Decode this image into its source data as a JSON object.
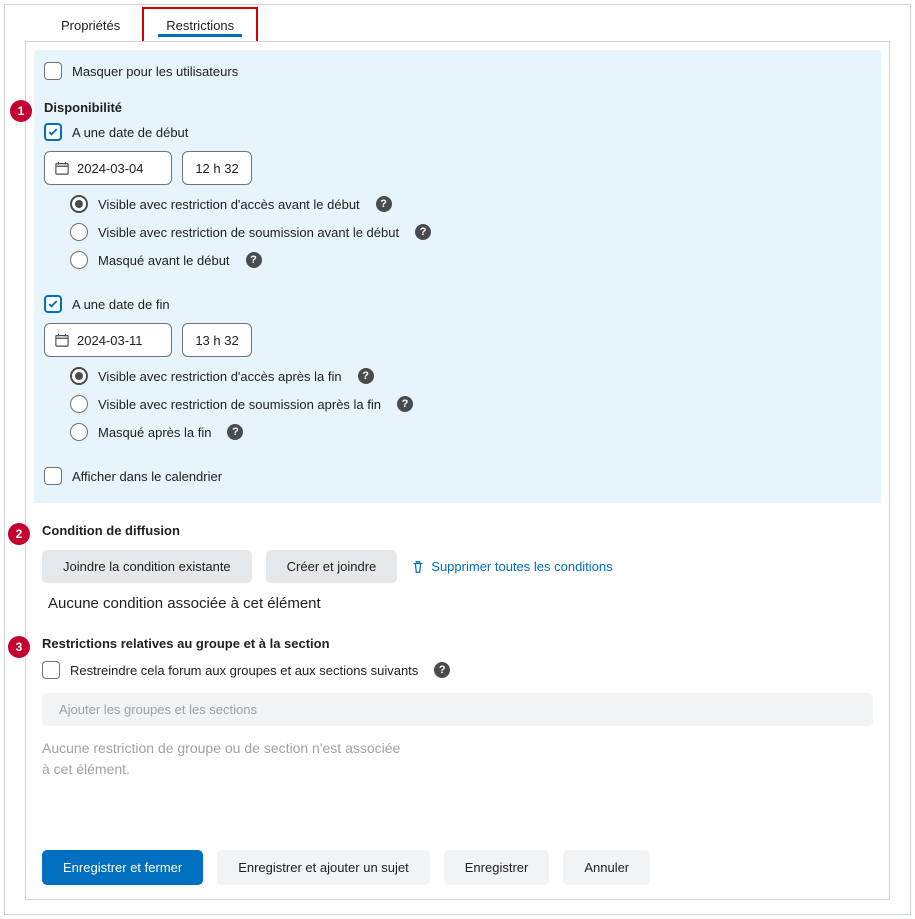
{
  "tabs": {
    "properties": "Propriétés",
    "restrictions": "Restrictions"
  },
  "hide_users": "Masquer pour les utilisateurs",
  "availability": {
    "title": "Disponibilité",
    "start": {
      "label": "A une date de début",
      "date": "2024-03-04",
      "time": "12 h 32",
      "opts": {
        "access": "Visible avec restriction d'accès avant le début",
        "submit": "Visible avec restriction de soumission avant le début",
        "hidden": "Masqué avant le début"
      }
    },
    "end": {
      "label": "A une date de fin",
      "date": "2024-03-11",
      "time": "13 h 32",
      "opts": {
        "access": "Visible avec restriction d'accès après la fin",
        "submit": "Visible avec restriction de soumission après la fin",
        "hidden": "Masqué après la fin"
      }
    },
    "calendar": "Afficher dans le calendrier"
  },
  "release": {
    "title": "Condition de diffusion",
    "attach": "Joindre la condition existante",
    "create": "Créer et joindre",
    "remove_all": "Supprimer toutes les conditions",
    "none": "Aucune condition associée à cet élément"
  },
  "group": {
    "title": "Restrictions relatives au groupe et à la section",
    "restrict": "Restreindre cela forum aux groupes et aux sections suivants",
    "add": "Ajouter les groupes et les sections",
    "none": "Aucune restriction de groupe ou de section n'est associée à cet élément."
  },
  "footer": {
    "save_close": "Enregistrer et fermer",
    "save_add": "Enregistrer et ajouter un sujet",
    "save": "Enregistrer",
    "cancel": "Annuler"
  },
  "markers": {
    "m1": "1",
    "m2": "2",
    "m3": "3"
  }
}
